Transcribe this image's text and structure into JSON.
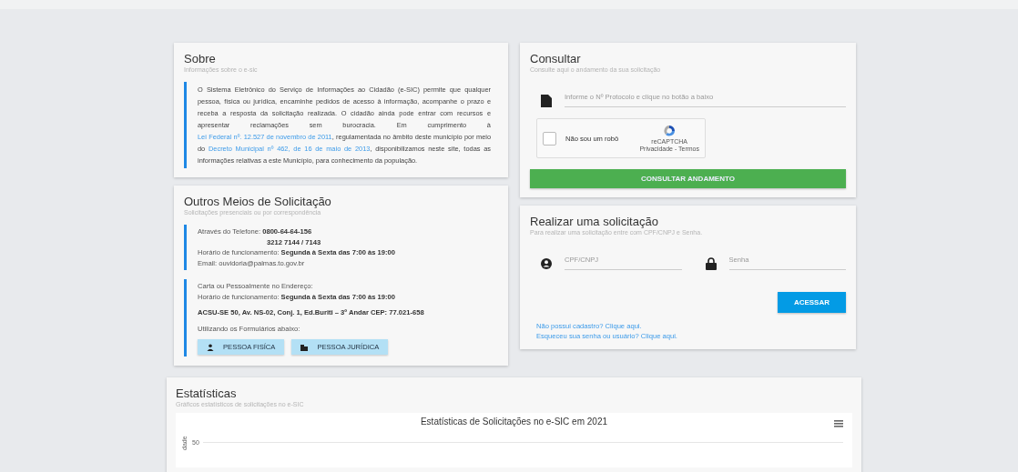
{
  "sobre": {
    "title": "Sobre",
    "subtitle": "Informações sobre o e-sic",
    "paragraph": [
      {
        "kind": "text",
        "text": "O Sistema Eletrônico do Serviço de Informações ao Cidadão (e-SIC) permite que qualquer pessoa, física ou jurídica, encaminhe pedidos de acesso à informação, acompanhe o prazo e receba a resposta da solicitação realizada. O cidadão ainda pode entrar com recursos e apresentar reclamações sem burocracia. Em cumprimento à "
      },
      {
        "kind": "link",
        "text": "Lei Federal nº. 12.527 de novembro de 2011"
      },
      {
        "kind": "text",
        "text": ", regulamentada no âmbito deste município por meio do "
      },
      {
        "kind": "link",
        "text": "Decreto Municipal nº 462, de 16 de maio de 2013"
      },
      {
        "kind": "text",
        "text": ", disponibilizamos neste site, todas as informações relativas a este Município, para conhecimento da população."
      }
    ]
  },
  "outros": {
    "title": "Outros Meios de Solicitação",
    "subtitle": "Solicitações presenciais ou por correspondência",
    "blocks": [
      {
        "lines": [
          {
            "kind": "line",
            "text": "Através do Telefone: **0800-64-64-156**"
          },
          {
            "kind": "indent",
            "text": "3212 7144 / 7143"
          },
          {
            "kind": "line",
            "text": "Horário de funcionamento: **Segunda à Sexta das 7:00 às 19:00**"
          },
          {
            "kind": "line",
            "text": "Email: ouvidoria@palmas.to.gov.br"
          }
        ]
      },
      {
        "lines": [
          {
            "kind": "line",
            "text": "Carta ou Pessoalmente no Endereço:"
          },
          {
            "kind": "line",
            "text": "Horário de funcionamento: **Segunda à Sexta das 7:00 às 19:00**"
          },
          {
            "kind": "gapbold",
            "text": "ACSU-SE 50, Av. NS-02, Conj. 1, Ed.Buriti – 3º Andar CEP: 77.021-658"
          },
          {
            "kind": "gap",
            "text": "Utilizando os Formulários abaixo:"
          }
        ],
        "buttons": [
          {
            "kind": "person",
            "label": "PESSOA FISÍCA"
          },
          {
            "kind": "company",
            "label": "PESSOA JURÍDICA"
          }
        ]
      }
    ]
  },
  "consultar": {
    "title": "Consultar",
    "subtitle": "Consulte aqui o andamento da sua solicitação",
    "protocol_placeholder": "Informe o Nº Protocolo e clique no botão a baixo",
    "captcha": {
      "label": "Não sou um robô",
      "checked": false,
      "brand": "reCAPTCHA",
      "terms": "Privacidade - Termos"
    },
    "button": "CONSULTAR ANDAMENTO"
  },
  "realizar": {
    "title": "Realizar uma solicitação",
    "subtitle": "Para realizar uma solicitação entre com CPF/CNPJ e Senha.",
    "cpf_placeholder": "CPF/CNPJ",
    "password_placeholder": "Senha",
    "button": "ACESSAR",
    "links": [
      "Não possui cadastro? Clique aqui.",
      "Esqueceu sua senha ou usuário? Clique aqui."
    ]
  },
  "estatisticas": {
    "title": "Estatísticas",
    "subtitle": "Gráficos estatísticos de solicitações no e-SIC",
    "chart_title": "Estatísticas de Solicitações no e-SIC em 2021",
    "ytick": "50",
    "ylabel_visible": "dade"
  }
}
